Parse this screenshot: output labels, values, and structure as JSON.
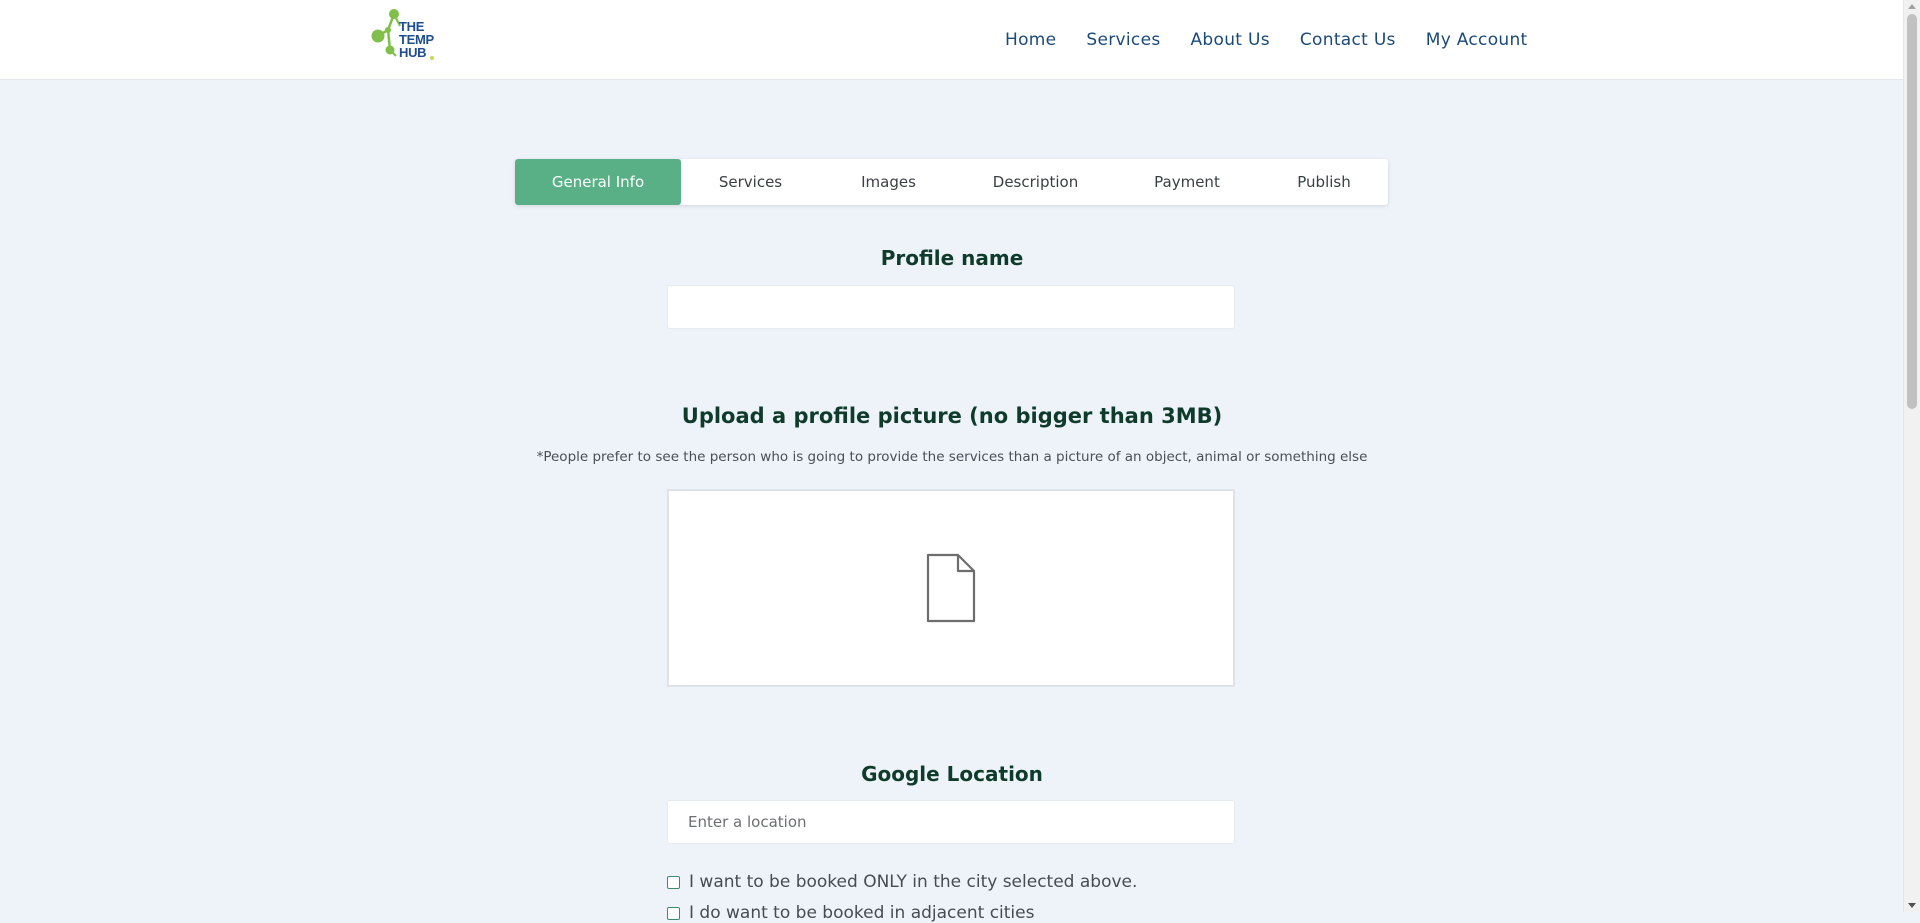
{
  "logo": {
    "line1": "THE",
    "line2": "TEMP",
    "line3": "HUB"
  },
  "nav": [
    "Home",
    "Services",
    "About Us",
    "Contact Us",
    "My Account"
  ],
  "tabs": [
    "General Info",
    "Services",
    "Images",
    "Description",
    "Payment",
    "Publish"
  ],
  "active_tab": "General Info",
  "profile_name": {
    "title": "Profile name",
    "value": "",
    "placeholder": ""
  },
  "upload": {
    "title": "Upload a profile picture (no bigger than 3MB)",
    "note": "*People prefer to see the person who is going to provide the services than a picture of an object, animal or something else"
  },
  "location": {
    "title": "Google Location",
    "placeholder": "Enter a location"
  },
  "checkboxes": [
    {
      "label": "I want to be booked ONLY in the city selected above.",
      "checked": false
    },
    {
      "label": "I do want to be booked in adjacent cities",
      "checked": false
    }
  ],
  "colors": {
    "accent": "#5ab086",
    "nav_text": "#1b4a78",
    "heading": "#0f3b2a",
    "background": "#eef3f9"
  },
  "icons": {
    "upload": "file-icon"
  }
}
